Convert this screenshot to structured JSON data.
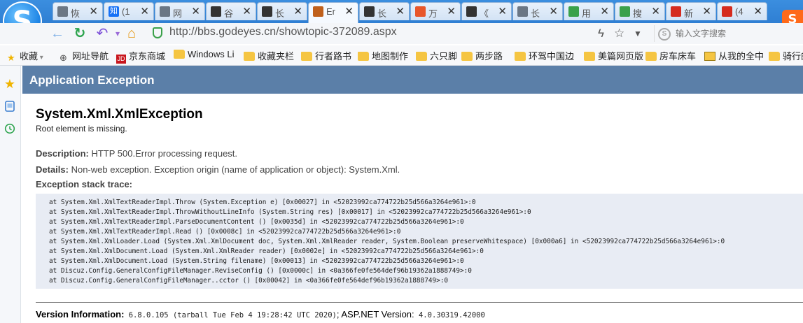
{
  "tabs": [
    {
      "label": "恢",
      "icon": "document-icon",
      "color": "#6b7785"
    },
    {
      "label": "(1",
      "icon": "zhihu-icon",
      "color": "#1772f6"
    },
    {
      "label": "网",
      "icon": "globe-icon",
      "color": "#6b7785"
    },
    {
      "label": "谷",
      "icon": "changcheng-icon",
      "color": "#333333"
    },
    {
      "label": "长",
      "icon": "changcheng-icon",
      "color": "#333333"
    },
    {
      "label": "Er",
      "icon": "error-page-icon",
      "color": "#c0601b"
    },
    {
      "label": "长",
      "icon": "changcheng-icon",
      "color": "#333333"
    },
    {
      "label": "万",
      "icon": "sogou-icon",
      "color": "#e8562a"
    },
    {
      "label": "《",
      "icon": "changcheng-icon",
      "color": "#333333"
    },
    {
      "label": "长",
      "icon": "document-icon",
      "color": "#6b7785"
    },
    {
      "label": "用",
      "icon": "footprint-icon",
      "color": "#3aa14a"
    },
    {
      "label": "搜",
      "icon": "footprint-icon",
      "color": "#3aa14a"
    },
    {
      "label": "新",
      "icon": "weibo-icon",
      "color": "#d52b1e"
    },
    {
      "label": "(4",
      "icon": "weibo-icon",
      "color": "#d52b1e"
    }
  ],
  "tab_close_glyph": "✕",
  "zhihu_glyph": "知",
  "address": {
    "url": "http://bbs.godeyes.cn/showtopic-372089.aspx",
    "search_placeholder": "输入文字搜索",
    "search_engine_glyph": "S"
  },
  "bookmarks": [
    {
      "label": "收藏",
      "icon": "star-icon"
    },
    {
      "label": "网址导航",
      "icon": "globe-icon"
    },
    {
      "label": "京东商城",
      "icon": "jd-icon"
    },
    {
      "label": "Windows Li",
      "icon": "folder-icon"
    },
    {
      "label": "收藏夹栏",
      "icon": "folder-icon"
    },
    {
      "label": "行者路书",
      "icon": "folder-icon"
    },
    {
      "label": "地图制作",
      "icon": "folder-icon"
    },
    {
      "label": "六只脚",
      "icon": "folder-icon"
    },
    {
      "label": "两步路",
      "icon": "folder-icon"
    },
    {
      "label": "环驾中国边",
      "icon": "folder-icon"
    },
    {
      "label": "美篇网页版",
      "icon": "folder-icon"
    },
    {
      "label": "房车床车",
      "icon": "folder-icon"
    },
    {
      "label": "从我的全中",
      "icon": "mail-icon"
    },
    {
      "label": "骑行的",
      "icon": "folder-icon"
    }
  ],
  "jd_glyph": "JD",
  "page": {
    "header": "Application Exception",
    "exception_type": "System.Xml.XmlException",
    "exception_message": "Root element is missing.",
    "description_label": "Description:",
    "description_text": " HTTP 500.Error processing request.",
    "details_label": "Details:",
    "details_text": " Non-web exception. Exception origin (name of application or object): System.Xml.",
    "stack_label": "Exception stack trace:",
    "stack_trace": [
      "at System.Xml.XmlTextReaderImpl.Throw (System.Exception e) [0x00027] in <52023992ca774722b25d566a3264e961>:0",
      "at System.Xml.XmlTextReaderImpl.ThrowWithoutLineInfo (System.String res) [0x00017] in <52023992ca774722b25d566a3264e961>:0",
      "at System.Xml.XmlTextReaderImpl.ParseDocumentContent () [0x0035d] in <52023992ca774722b25d566a3264e961>:0",
      "at System.Xml.XmlTextReaderImpl.Read () [0x0008c] in <52023992ca774722b25d566a3264e961>:0",
      "at System.Xml.XmlLoader.Load (System.Xml.XmlDocument doc, System.Xml.XmlReader reader, System.Boolean preserveWhitespace) [0x000a6] in <52023992ca774722b25d566a3264e961>:0",
      "at System.Xml.XmlDocument.Load (System.Xml.XmlReader reader) [0x0002e] in <52023992ca774722b25d566a3264e961>:0",
      "at System.Xml.XmlDocument.Load (System.String filename) [0x00013] in <52023992ca774722b25d566a3264e961>:0",
      "at Discuz.Config.GeneralConfigFileManager.ReviseConfig () [0x0000c] in <0a366fe0fe564def96b19362a1888749>:0",
      "at Discuz.Config.GeneralConfigFileManager..cctor () [0x00042] in <0a366fe0fe564def96b19362a1888749>:0"
    ],
    "version_label": "Version Information:",
    "version_mono": " 6.8.0.105 (tarball Tue Feb 4 19:28:42 UTC 2020)",
    "version_sep": "; ASP.NET Version:",
    "aspnet_version": " 4.0.30319.42000"
  },
  "colors": {
    "header_band": "#5b7fa8",
    "stack_bg": "#e8ecf4",
    "tabbar": "#2f7fd3"
  }
}
